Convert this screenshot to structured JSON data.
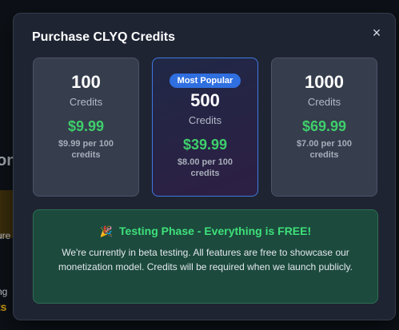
{
  "modal": {
    "title": "Purchase CLYQ Credits",
    "close_icon": "×",
    "close_icon_name": "close-icon"
  },
  "packages": [
    {
      "quantity": "100",
      "unit": "Credits",
      "price": "$9.99",
      "per_unit": "$9.99 per 100 credits",
      "badge": ""
    },
    {
      "quantity": "500",
      "unit": "Credits",
      "price": "$39.99",
      "per_unit": "$8.00 per 100 credits",
      "badge": "Most Popular"
    },
    {
      "quantity": "1000",
      "unit": "Credits",
      "price": "$69.99",
      "per_unit": "$7.00 per 100 credits",
      "badge": ""
    }
  ],
  "notice": {
    "emoji": "🎉",
    "emoji_name": "party-popper-icon",
    "heading": "Testing Phase - Everything is FREE!",
    "body": "We're currently in beta testing. All features are free to showcase our monetization model. Credits will be required when we launch publicly."
  },
  "background": {
    "partial_text_1": "on",
    "partial_text_2": "ure",
    "partial_text_3": "ng",
    "partial_text_4": "ts"
  },
  "colors": {
    "accent": "#2f6fe0",
    "price": "#3ecf6b",
    "notice_bg": "#1c4a3d"
  }
}
